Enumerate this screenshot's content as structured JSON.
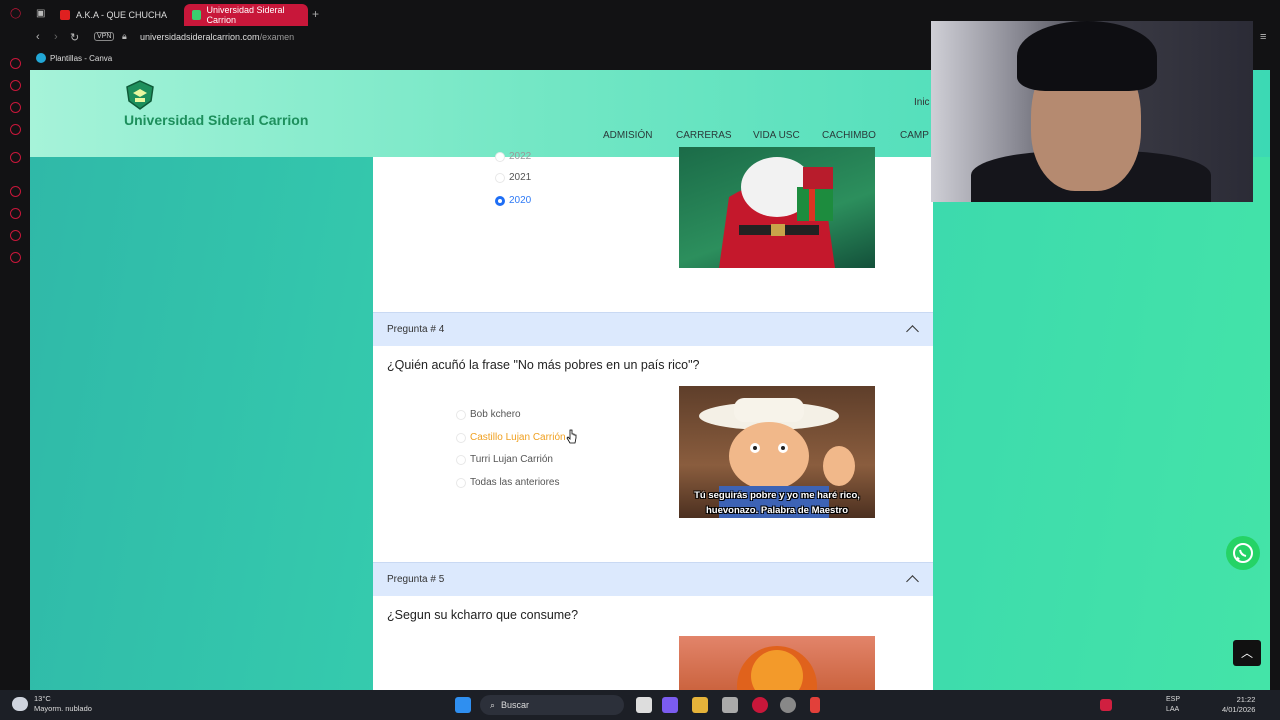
{
  "browser": {
    "tabs": [
      {
        "label": "A.K.A - QUE CHUCHA",
        "active": false
      },
      {
        "label": "Universidad Sideral Carrion",
        "active": true
      }
    ],
    "url_domain": "universidadsideralcarrion.com",
    "url_path": "/examen",
    "vpn_label": "VPN",
    "bookmark": "Plantillas - Canva"
  },
  "site": {
    "brand": "Universidad Sideral Carrion",
    "top_link": "Inic",
    "nav": [
      "ADMISIÓN",
      "CARRERAS",
      "VIDA USC",
      "CACHIMBO",
      "CAMP"
    ]
  },
  "question3": {
    "options": [
      {
        "label": "2022",
        "checked": false
      },
      {
        "label": "2021",
        "checked": false
      },
      {
        "label": "2020",
        "checked": true
      }
    ]
  },
  "question4": {
    "header": "Pregunta # 4",
    "text": "¿Quién acuñó la frase \"No más pobres en un país rico\"?",
    "options": [
      "Bob kchero",
      "Castillo Lujan Carrión",
      "Turri Lujan Carrión",
      "Todas las anteriores"
    ],
    "image_caption_line1": "Tú seguirás pobre y yo me haré rico,",
    "image_caption_line2": "huevonazo. Palabra de Maestro"
  },
  "question5": {
    "header": "Pregunta # 5",
    "text": "¿Segun su kcharro que consume?"
  },
  "taskbar": {
    "temp": "13°C",
    "weather": "Mayorm. nublado",
    "search": "Buscar",
    "lang1": "ESP",
    "lang2": "LAA",
    "time": "21:22",
    "date": "4/01/2026"
  },
  "colors": {
    "accent_red": "#c8173a",
    "brand_green": "#1d8f5c",
    "question_header_bg": "#dce9fd",
    "radio_selected": "#1e6ef5",
    "hover_option": "#f0a020",
    "whatsapp": "#25d366"
  }
}
